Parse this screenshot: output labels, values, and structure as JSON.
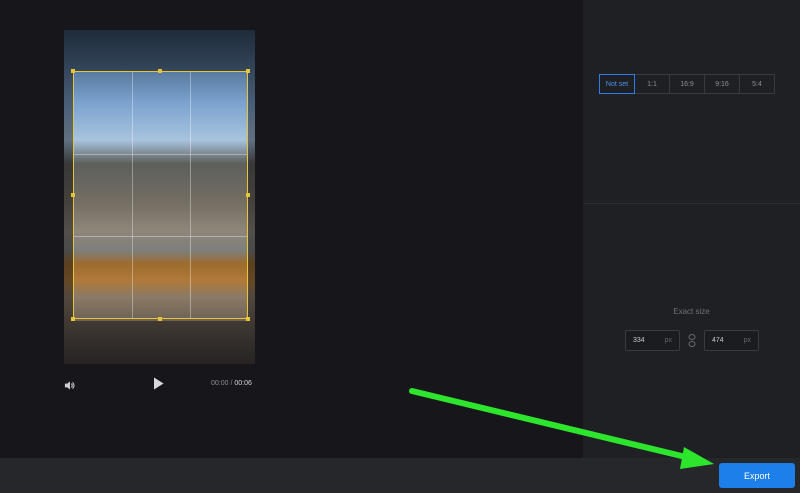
{
  "aspect_ratios": {
    "options": [
      "Not set",
      "1:1",
      "16:9",
      "9:16",
      "5:4"
    ],
    "selected": "Not set"
  },
  "player": {
    "current_time": "00:00",
    "separator": "/",
    "duration": "00:06"
  },
  "exact_size": {
    "label": "Exact size",
    "width": "334",
    "height": "474",
    "unit": "px"
  },
  "footer": {
    "export_label": "Export"
  },
  "colors": {
    "accent": "#1d7fe9",
    "crop_frame": "#e6c53a",
    "annotation_arrow": "#2ee52e"
  },
  "icons": [
    "volume-icon",
    "play-icon",
    "link-icon",
    "green-annotation-arrow"
  ]
}
